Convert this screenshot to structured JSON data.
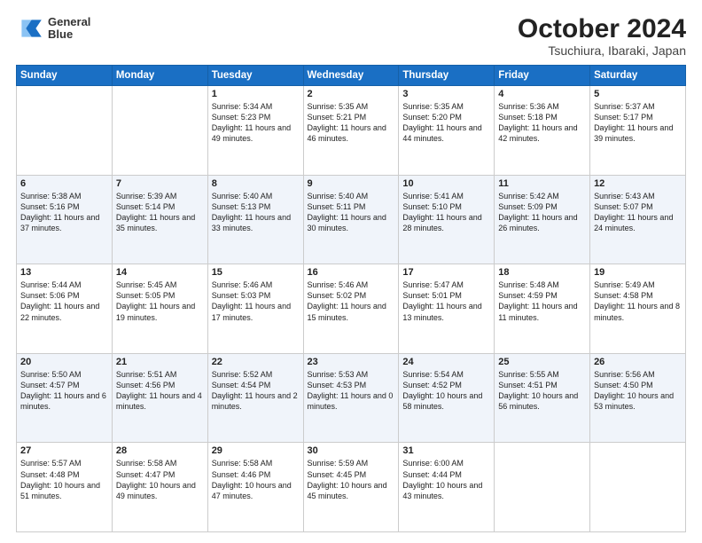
{
  "header": {
    "logo": {
      "line1": "General",
      "line2": "Blue"
    },
    "title": "October 2024",
    "subtitle": "Tsuchiura, Ibaraki, Japan"
  },
  "columns": [
    "Sunday",
    "Monday",
    "Tuesday",
    "Wednesday",
    "Thursday",
    "Friday",
    "Saturday"
  ],
  "weeks": [
    [
      {
        "day": "",
        "info": ""
      },
      {
        "day": "",
        "info": ""
      },
      {
        "day": "1",
        "info": "Sunrise: 5:34 AM\nSunset: 5:23 PM\nDaylight: 11 hours and 49 minutes."
      },
      {
        "day": "2",
        "info": "Sunrise: 5:35 AM\nSunset: 5:21 PM\nDaylight: 11 hours and 46 minutes."
      },
      {
        "day": "3",
        "info": "Sunrise: 5:35 AM\nSunset: 5:20 PM\nDaylight: 11 hours and 44 minutes."
      },
      {
        "day": "4",
        "info": "Sunrise: 5:36 AM\nSunset: 5:18 PM\nDaylight: 11 hours and 42 minutes."
      },
      {
        "day": "5",
        "info": "Sunrise: 5:37 AM\nSunset: 5:17 PM\nDaylight: 11 hours and 39 minutes."
      }
    ],
    [
      {
        "day": "6",
        "info": "Sunrise: 5:38 AM\nSunset: 5:16 PM\nDaylight: 11 hours and 37 minutes."
      },
      {
        "day": "7",
        "info": "Sunrise: 5:39 AM\nSunset: 5:14 PM\nDaylight: 11 hours and 35 minutes."
      },
      {
        "day": "8",
        "info": "Sunrise: 5:40 AM\nSunset: 5:13 PM\nDaylight: 11 hours and 33 minutes."
      },
      {
        "day": "9",
        "info": "Sunrise: 5:40 AM\nSunset: 5:11 PM\nDaylight: 11 hours and 30 minutes."
      },
      {
        "day": "10",
        "info": "Sunrise: 5:41 AM\nSunset: 5:10 PM\nDaylight: 11 hours and 28 minutes."
      },
      {
        "day": "11",
        "info": "Sunrise: 5:42 AM\nSunset: 5:09 PM\nDaylight: 11 hours and 26 minutes."
      },
      {
        "day": "12",
        "info": "Sunrise: 5:43 AM\nSunset: 5:07 PM\nDaylight: 11 hours and 24 minutes."
      }
    ],
    [
      {
        "day": "13",
        "info": "Sunrise: 5:44 AM\nSunset: 5:06 PM\nDaylight: 11 hours and 22 minutes."
      },
      {
        "day": "14",
        "info": "Sunrise: 5:45 AM\nSunset: 5:05 PM\nDaylight: 11 hours and 19 minutes."
      },
      {
        "day": "15",
        "info": "Sunrise: 5:46 AM\nSunset: 5:03 PM\nDaylight: 11 hours and 17 minutes."
      },
      {
        "day": "16",
        "info": "Sunrise: 5:46 AM\nSunset: 5:02 PM\nDaylight: 11 hours and 15 minutes."
      },
      {
        "day": "17",
        "info": "Sunrise: 5:47 AM\nSunset: 5:01 PM\nDaylight: 11 hours and 13 minutes."
      },
      {
        "day": "18",
        "info": "Sunrise: 5:48 AM\nSunset: 4:59 PM\nDaylight: 11 hours and 11 minutes."
      },
      {
        "day": "19",
        "info": "Sunrise: 5:49 AM\nSunset: 4:58 PM\nDaylight: 11 hours and 8 minutes."
      }
    ],
    [
      {
        "day": "20",
        "info": "Sunrise: 5:50 AM\nSunset: 4:57 PM\nDaylight: 11 hours and 6 minutes."
      },
      {
        "day": "21",
        "info": "Sunrise: 5:51 AM\nSunset: 4:56 PM\nDaylight: 11 hours and 4 minutes."
      },
      {
        "day": "22",
        "info": "Sunrise: 5:52 AM\nSunset: 4:54 PM\nDaylight: 11 hours and 2 minutes."
      },
      {
        "day": "23",
        "info": "Sunrise: 5:53 AM\nSunset: 4:53 PM\nDaylight: 11 hours and 0 minutes."
      },
      {
        "day": "24",
        "info": "Sunrise: 5:54 AM\nSunset: 4:52 PM\nDaylight: 10 hours and 58 minutes."
      },
      {
        "day": "25",
        "info": "Sunrise: 5:55 AM\nSunset: 4:51 PM\nDaylight: 10 hours and 56 minutes."
      },
      {
        "day": "26",
        "info": "Sunrise: 5:56 AM\nSunset: 4:50 PM\nDaylight: 10 hours and 53 minutes."
      }
    ],
    [
      {
        "day": "27",
        "info": "Sunrise: 5:57 AM\nSunset: 4:48 PM\nDaylight: 10 hours and 51 minutes."
      },
      {
        "day": "28",
        "info": "Sunrise: 5:58 AM\nSunset: 4:47 PM\nDaylight: 10 hours and 49 minutes."
      },
      {
        "day": "29",
        "info": "Sunrise: 5:58 AM\nSunset: 4:46 PM\nDaylight: 10 hours and 47 minutes."
      },
      {
        "day": "30",
        "info": "Sunrise: 5:59 AM\nSunset: 4:45 PM\nDaylight: 10 hours and 45 minutes."
      },
      {
        "day": "31",
        "info": "Sunrise: 6:00 AM\nSunset: 4:44 PM\nDaylight: 10 hours and 43 minutes."
      },
      {
        "day": "",
        "info": ""
      },
      {
        "day": "",
        "info": ""
      }
    ]
  ]
}
